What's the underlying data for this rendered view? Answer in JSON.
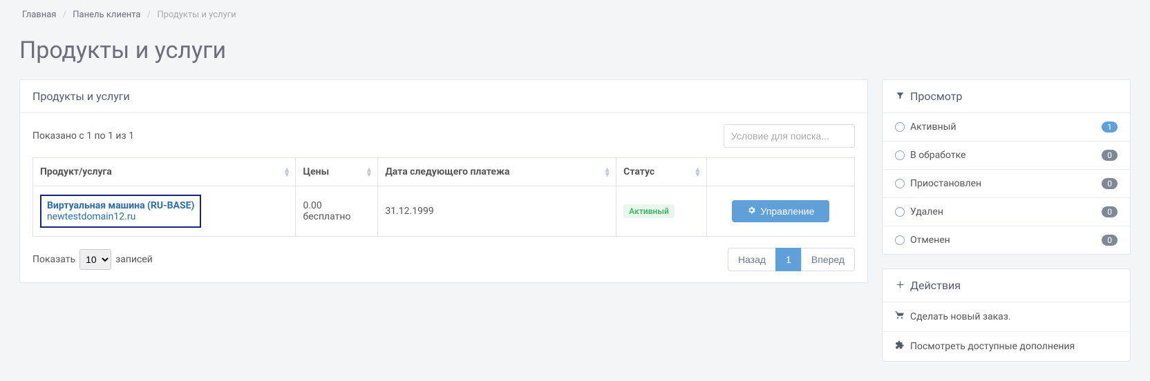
{
  "breadcrumb": {
    "home": "Главная",
    "panel": "Панель клиента",
    "current": "Продукты и услуги"
  },
  "page_title": "Продукты и услуги",
  "main": {
    "panel_title": "Продукты и услуги",
    "records_info": "Показано с 1 по 1 из 1",
    "search_placeholder": "Условие для поиска...",
    "columns": {
      "product": "Продукт/услуга",
      "price": "Цены",
      "next_due": "Дата следующего платежа",
      "status": "Статус"
    },
    "row": {
      "product_name": "Виртуальная машина (RU-BASE)",
      "product_domain": "newtestdomain12.ru",
      "price_amount": "0.00",
      "price_cycle": "бесплатно",
      "next_due": "31.12.1999",
      "status": "Активный",
      "manage_label": "Управление"
    },
    "footer": {
      "show_label": "Показать",
      "entries_label": "записей",
      "page_size": "10",
      "prev": "Назад",
      "page_current": "1",
      "next": "Вперед"
    }
  },
  "sidebar": {
    "view": {
      "title": "Просмотр",
      "filters": [
        {
          "label": "Активный",
          "count": "1",
          "zero": false
        },
        {
          "label": "В обработке",
          "count": "0",
          "zero": true
        },
        {
          "label": "Приостановлен",
          "count": "0",
          "zero": true
        },
        {
          "label": "Удален",
          "count": "0",
          "zero": true
        },
        {
          "label": "Отменен",
          "count": "0",
          "zero": true
        }
      ]
    },
    "actions": {
      "title": "Действия",
      "items": [
        {
          "icon": "cart-icon",
          "label": "Сделать новый заказ."
        },
        {
          "icon": "puzzle-icon",
          "label": "Посмотреть доступные дополнения"
        }
      ]
    }
  }
}
